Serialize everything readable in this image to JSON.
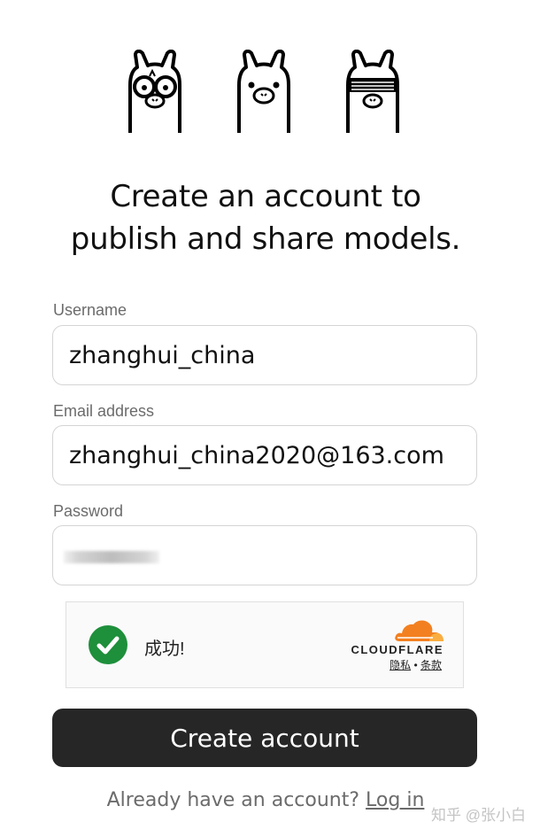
{
  "mascots": [
    "llama-glasses-icon",
    "llama-icon",
    "llama-sunglasses-icon"
  ],
  "headline": {
    "line1": "Create an account to",
    "line2": "publish and share models."
  },
  "form": {
    "username_label": "Username",
    "username_value": "zhanghui_china",
    "email_label": "Email address",
    "email_value": "zhanghui_china2020@163.com",
    "password_label": "Password",
    "password_value": ""
  },
  "captcha": {
    "status": "成功!",
    "brand": "CLOUDFLARE",
    "privacy_link": "隐私",
    "separator": "•",
    "terms_link": "条款"
  },
  "submit_label": "Create account",
  "footer": {
    "prompt": "Already have an account?",
    "login_link": "Log in"
  },
  "watermark": "知乎 @张小白",
  "colors": {
    "button_bg": "#262626",
    "success_green": "#1e8f3b",
    "cloudflare_orange": "#f38020"
  }
}
